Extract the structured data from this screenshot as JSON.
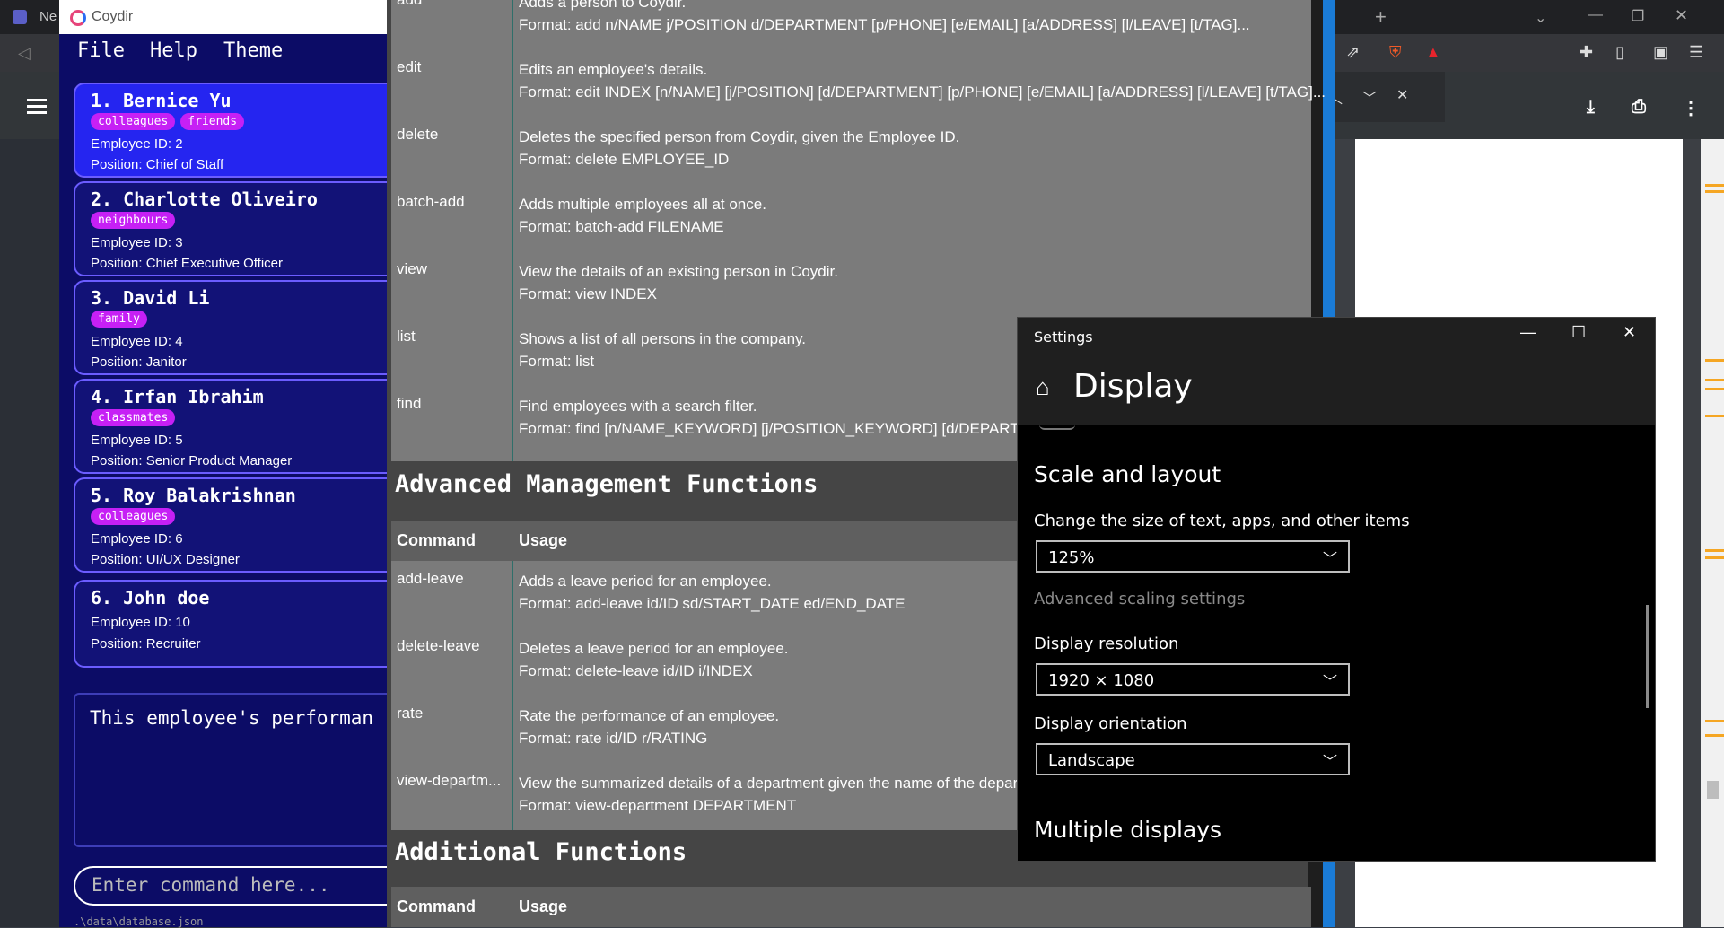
{
  "browser": {
    "left_tab_label": "Ne",
    "new_tab_symbol": "+"
  },
  "coydir": {
    "window_title": "Coydir",
    "menu": [
      "File",
      "Help",
      "Theme"
    ],
    "employees": [
      {
        "name": "1.  Bernice Yu",
        "tags": [
          "colleagues",
          "friends"
        ],
        "id_line": "Employee ID:  2",
        "position_line": "Position:  Chief of Staff"
      },
      {
        "name": "2.  Charlotte Oliveiro",
        "tags": [
          "neighbours"
        ],
        "id_line": "Employee ID:  3",
        "position_line": "Position:  Chief Executive Officer"
      },
      {
        "name": "3.  David Li",
        "tags": [
          "family"
        ],
        "id_line": "Employee ID:  4",
        "position_line": "Position:  Janitor"
      },
      {
        "name": "4.  Irfan Ibrahim",
        "tags": [
          "classmates"
        ],
        "id_line": "Employee ID:  5",
        "position_line": "Position:  Senior Product Manager"
      },
      {
        "name": "5.  Roy Balakrishnan",
        "tags": [
          "colleagues"
        ],
        "id_line": "Employee ID:  6",
        "position_line": "Position:  UI/UX Designer"
      },
      {
        "name": "6.  John doe",
        "tags": [],
        "id_line": "Employee ID:  10",
        "position_line": "Position:  Recruiter"
      }
    ],
    "result_text": "This employee's performan",
    "command_placeholder": "Enter command here...",
    "status_text": ".\\data\\database.json"
  },
  "help": {
    "basic_rows": [
      {
        "cmd": "add",
        "desc1": "Adds a person to Coydir.",
        "desc2": "Format: add n/NAME j/POSITION d/DEPARTMENT [p/PHONE] [e/EMAIL] [a/ADDRESS] [l/LEAVE] [t/TAG]..."
      },
      {
        "cmd": "edit",
        "desc1": "Edits an employee's details.",
        "desc2": "Format: edit INDEX [n/NAME] [j/POSITION] [d/DEPARTMENT] [p/PHONE] [e/EMAIL] [a/ADDRESS] [l/LEAVE] [t/TAG]..."
      },
      {
        "cmd": "delete",
        "desc1": "Deletes the specified person from Coydir, given the Employee ID.",
        "desc2": "Format: delete EMPLOYEE_ID"
      },
      {
        "cmd": "batch-add",
        "desc1": "Adds multiple employees all at once.",
        "desc2": "Format: batch-add FILENAME"
      },
      {
        "cmd": "view",
        "desc1": "View the details of an existing person in Coydir.",
        "desc2": "Format: view INDEX"
      },
      {
        "cmd": "list",
        "desc1": "Shows a list of all persons in the company.",
        "desc2": "Format: list"
      },
      {
        "cmd": "find",
        "desc1": "Find employees with a search filter.",
        "desc2": "Format: find [n/NAME_KEYWORD] [j/POSITION_KEYWORD] [d/DEPARTMEN"
      }
    ],
    "advanced_heading": "Advanced Management Functions",
    "col_command": "Command",
    "col_usage": "Usage",
    "advanced_rows": [
      {
        "cmd": "add-leave",
        "desc1": "Adds a leave period for an employee.",
        "desc2": "Format: add-leave id/ID sd/START_DATE ed/END_DATE"
      },
      {
        "cmd": "delete-leave",
        "desc1": "Deletes a leave period for an employee.",
        "desc2": "Format: delete-leave id/ID i/INDEX"
      },
      {
        "cmd": "rate",
        "desc1": "Rate the performance of an employee.",
        "desc2": "Format: rate id/ID r/RATING"
      },
      {
        "cmd": "view-departm...",
        "desc1": "View the summarized details of a department given the name of the depart",
        "desc2": "Format: view-department DEPARTMENT"
      }
    ],
    "additional_heading": "Additional Functions",
    "col_command_2": "Command",
    "col_usage_2": "Usage"
  },
  "settings": {
    "window_title": "Settings",
    "page_title": "Display",
    "scale_heading": "Scale and layout",
    "scale_label": "Change the size of text, apps, and other items",
    "scale_value": "125%",
    "advanced_scaling_link": "Advanced scaling settings",
    "resolution_label": "Display resolution",
    "resolution_value": "1920 × 1080",
    "orientation_label": "Display orientation",
    "orientation_value": "Landscape",
    "multiple_heading": "Multiple displays"
  }
}
